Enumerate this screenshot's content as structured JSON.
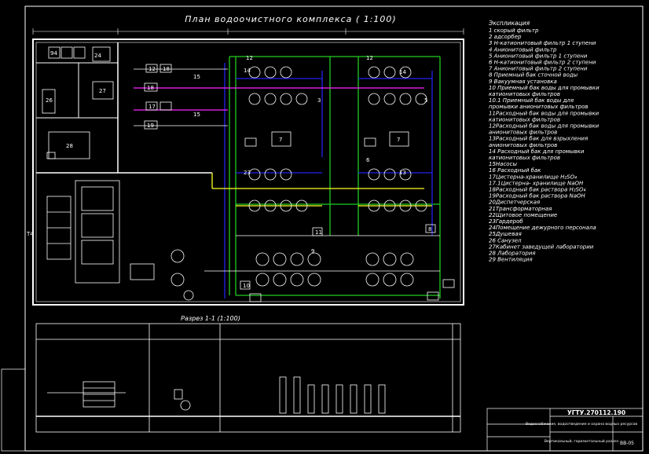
{
  "drawing": {
    "title": "План водоочистного комплекса ( 1:100)",
    "section_title": "Разрез 1-1 (1:100)",
    "left_marker": "Т4",
    "plan_labels": {
      "room_94": "94",
      "room_27": "27",
      "room_28": "28",
      "room_26": "26",
      "room_24": "24",
      "valve_18a": "18",
      "valve_18b": "18",
      "valve_19": "19",
      "pump_12": "12",
      "pump_17": "17",
      "pump_15a": "15",
      "pump_15b": "15",
      "unit_14a": "14",
      "unit_14b": "14",
      "unit_7a": "7",
      "unit_7b": "7",
      "unit_23": "23",
      "unit_13": "13",
      "unit_12a": "12",
      "unit_12b": "12",
      "unit_6": "6",
      "unit_9": "9",
      "unit_10": "10",
      "unit_11": "11",
      "unit_8": "8",
      "sub_3": "3",
      "sub_5": "5"
    }
  },
  "legend": {
    "heading": "Экспликация",
    "items": [
      "1 скорый фильтр",
      "2 адсорбер",
      "3 Н-катионитовый фильтр 1 ступени",
      "4 Анионитовый фильтр",
      "5 Анионитовый фильтр 1 ступени",
      "6 Н-катионитовый фильтр 2 ступени",
      "7 Анионитовый фильтр 2 ступени",
      "8 Приемный бак сточной воды",
      "9 Вакуумная установка",
      "10 Приемный бак воды для промывки катионитовых фильтров",
      "10.1 Приемный бак воды для промывки анионитовых фильтров",
      "11Расходный бак воды для промывки катионитовых фильтров",
      "12Расходный бак воды для промывки анионитовых фильтров",
      "13Расходный бак для взрыхления анионитовых фильтров",
      "14 Расходный бак для промывки катионитовых фильтров",
      "15Насосы",
      "16 Расходный бак",
      "17Цистерна-хранилище H₂SO₄",
      "17.1Цистерна- хранилище NaOH",
      "18Расходный бак раствора H₂SO₄",
      "19Расходный бак раствора NaOH",
      "20Диспетчерская",
      "21Трансформаторная",
      "22Щитовое помещение",
      "23Гардероб",
      "24Помещение дежурного персонала",
      "25Душевая",
      "26 Санузел",
      "27Кабинет заведущей лаборатории",
      "28 Лаборатория",
      "29 Вентиляция"
    ]
  },
  "stamp": {
    "code": "УГТУ.270112.190",
    "desc": "Водоснабжение, водоотведение и охрана водных ресурсов",
    "sheet": "ВВ-05",
    "view": "Вертикальный, горизонтальный разрез"
  },
  "colors": {
    "green": "#22cc22",
    "blue": "#2222ee",
    "magenta": "#ff22ff",
    "yellow": "#ffff22",
    "white": "#ffffff"
  }
}
